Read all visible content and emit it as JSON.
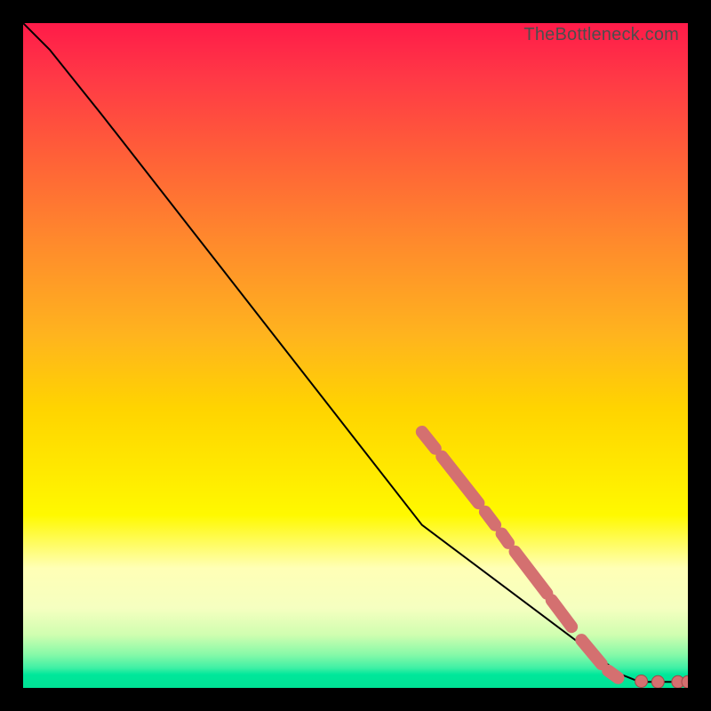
{
  "watermark": "TheBottleneck.com",
  "chart_data": {
    "type": "line",
    "title": "",
    "xlabel": "",
    "ylabel": "",
    "xlim": [
      0,
      100
    ],
    "ylim": [
      0,
      100
    ],
    "grid": false,
    "legend": false,
    "curve": [
      {
        "x": 0,
        "y": 100
      },
      {
        "x": 4,
        "y": 96
      },
      {
        "x": 8,
        "y": 91
      },
      {
        "x": 12,
        "y": 86
      },
      {
        "x": 60,
        "y": 24.5
      },
      {
        "x": 90,
        "y": 2
      },
      {
        "x": 92,
        "y": 1.2
      },
      {
        "x": 94,
        "y": 0.9
      },
      {
        "x": 100,
        "y": 0.9
      }
    ],
    "marker_segments": [
      {
        "x1": 60.0,
        "y1": 38.5,
        "x2": 62.0,
        "y2": 36.0
      },
      {
        "x1": 63.0,
        "y1": 34.8,
        "x2": 68.5,
        "y2": 27.8
      },
      {
        "x1": 69.5,
        "y1": 26.5,
        "x2": 71.0,
        "y2": 24.5
      },
      {
        "x1": 72.0,
        "y1": 23.2,
        "x2": 73.0,
        "y2": 21.8
      },
      {
        "x1": 74.0,
        "y1": 20.5,
        "x2": 78.8,
        "y2": 14.2
      },
      {
        "x1": 79.5,
        "y1": 13.2,
        "x2": 82.5,
        "y2": 9.2
      },
      {
        "x1": 84.0,
        "y1": 7.2,
        "x2": 87.0,
        "y2": 3.6
      },
      {
        "x1": 88.0,
        "y1": 2.6,
        "x2": 89.5,
        "y2": 1.5
      }
    ],
    "marker_dots": [
      {
        "x": 93.0,
        "y": 1.0
      },
      {
        "x": 95.5,
        "y": 0.9
      },
      {
        "x": 98.5,
        "y": 0.9
      },
      {
        "x": 100.0,
        "y": 0.9
      }
    ]
  }
}
